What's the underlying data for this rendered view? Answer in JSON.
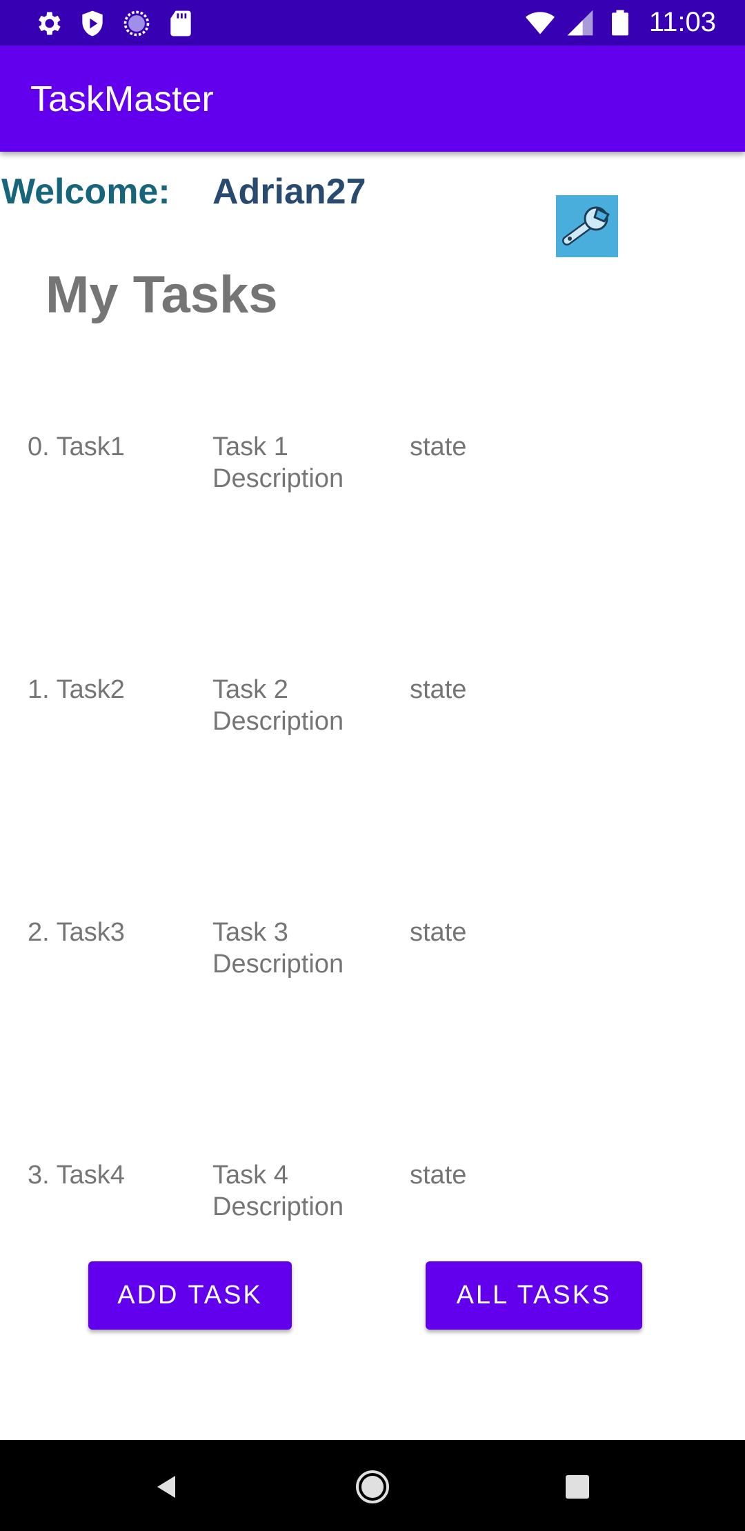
{
  "status_bar": {
    "time": "11:03",
    "left_icons": [
      "settings-icon",
      "play-protect-icon",
      "sync-icon",
      "sd-card-icon"
    ],
    "right_icons": [
      "wifi-icon",
      "cellular-signal-icon",
      "battery-icon"
    ]
  },
  "app_bar": {
    "title": "TaskMaster"
  },
  "welcome": {
    "label": "Welcome:",
    "username": "Adrian27"
  },
  "settings_button": {
    "icon": "wrench-icon"
  },
  "page_title": "My Tasks",
  "tasks": [
    {
      "name": "0. Task1",
      "description": "Task 1 Description",
      "state": "state"
    },
    {
      "name": "1. Task2",
      "description": "Task 2 Description",
      "state": "state"
    },
    {
      "name": "2. Task3",
      "description": "Task 3 Description",
      "state": "state"
    },
    {
      "name": "3. Task4",
      "description": "Task 4 Description",
      "state": "state"
    }
  ],
  "buttons": {
    "add_task": "ADD TASK",
    "all_tasks": "ALL TASKS"
  },
  "nav_bar": {
    "icons": [
      "back-icon",
      "home-icon",
      "recents-icon"
    ]
  },
  "colors": {
    "status_bar": "#3700b3",
    "app_bar": "#6200ee",
    "primary": "#6200ee",
    "welcome_label": "#17657a",
    "welcome_user": "#284a6e",
    "settings_bg": "#49aedb",
    "text_gray": "#757575"
  }
}
